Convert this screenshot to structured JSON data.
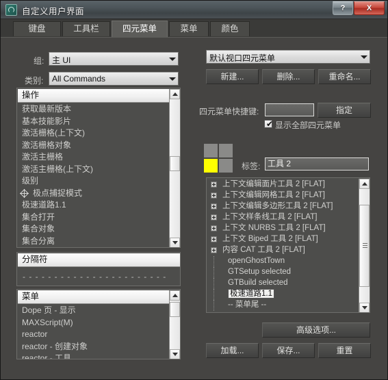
{
  "window": {
    "title": "自定义用户界面",
    "app_icon": "spiral-app-icon",
    "help_button": "?",
    "close_button": "X"
  },
  "tabs": [
    {
      "label": "键盘",
      "active": false
    },
    {
      "label": "工具栏",
      "active": false
    },
    {
      "label": "四元菜单",
      "active": true
    },
    {
      "label": "菜单",
      "active": false
    },
    {
      "label": "颜色",
      "active": false
    }
  ],
  "left_panel": {
    "group_label": "组:",
    "group_value": "主 UI",
    "category_label": "类别:",
    "category_value": "All Commands",
    "actions_list": {
      "header": "操作",
      "items": [
        {
          "label": "获取最新版本",
          "icon": null
        },
        {
          "label": "基本技能影片",
          "icon": null
        },
        {
          "label": "激活栅格(上下文)",
          "icon": null
        },
        {
          "label": "激活栅格对象",
          "icon": null
        },
        {
          "label": "激活主栅格",
          "icon": null
        },
        {
          "label": "激活主栅格(上下文)",
          "icon": null
        },
        {
          "label": "级别",
          "icon": null
        },
        {
          "label": "极点捕捉模式",
          "icon": "snap-icon"
        },
        {
          "label": "极速道路1.1",
          "icon": null
        },
        {
          "label": "集合打开",
          "icon": null
        },
        {
          "label": "集合对象",
          "icon": null
        },
        {
          "label": "集合分离",
          "icon": null
        }
      ]
    },
    "separator_list": {
      "header": "分隔符",
      "dash_row": "- - - - - - - - - - - - - - - - - - - - - - -"
    },
    "menus_list": {
      "header": "菜单",
      "items": [
        "Dope 页 - 显示",
        "MAXScript(M)",
        "reactor",
        "reactor - 创建对象",
        "reactor - 工具"
      ]
    }
  },
  "right_panel": {
    "quad_set_value": "默认视口四元菜单",
    "new_button": "新建...",
    "delete_button": "删除...",
    "rename_button": "重命名...",
    "shortcut_label": "四元菜单快捷键:",
    "shortcut_value": "",
    "assign_button": "指定",
    "show_all_label": "显示全部四元菜单",
    "show_all_checked": true,
    "quad_colors": {
      "top_left": "#8a8a88",
      "top_right": "#8a8a88",
      "bottom_left": "#ffff00",
      "bottom_right": "#8a8a88"
    },
    "tag_label": "标签:",
    "tag_value": "工具 2",
    "menu_items": [
      {
        "label": "上下文编辑面片工具 2 [FLAT]",
        "type": "group",
        "selected": false
      },
      {
        "label": "上下文编辑网格工具 2 [FLAT]",
        "type": "group",
        "selected": false
      },
      {
        "label": "上下文编辑多边形工具 2 [FLAT]",
        "type": "group",
        "selected": false
      },
      {
        "label": "上下文样条线工具 2 [FLAT]",
        "type": "group",
        "selected": false
      },
      {
        "label": "上下文 NURBS 工具 2 [FLAT]",
        "type": "group",
        "selected": false
      },
      {
        "label": "上下文 Biped 工具 2 [FLAT]",
        "type": "group",
        "selected": false
      },
      {
        "label": "内容 CAT 工具 2 [FLAT]",
        "type": "group",
        "selected": false
      },
      {
        "label": "openGhostTown",
        "type": "child",
        "selected": false
      },
      {
        "label": "GTSetup selected",
        "type": "child",
        "selected": false
      },
      {
        "label": "GTBuild selected",
        "type": "child",
        "selected": false
      },
      {
        "label": "极速道路1.1",
        "type": "child",
        "selected": true
      },
      {
        "label": "-- 菜单尾 --",
        "type": "child",
        "selected": false
      }
    ],
    "advanced_button": "高级选项...",
    "load_button": "加载...",
    "save_button": "保存...",
    "reset_button": "重置"
  }
}
